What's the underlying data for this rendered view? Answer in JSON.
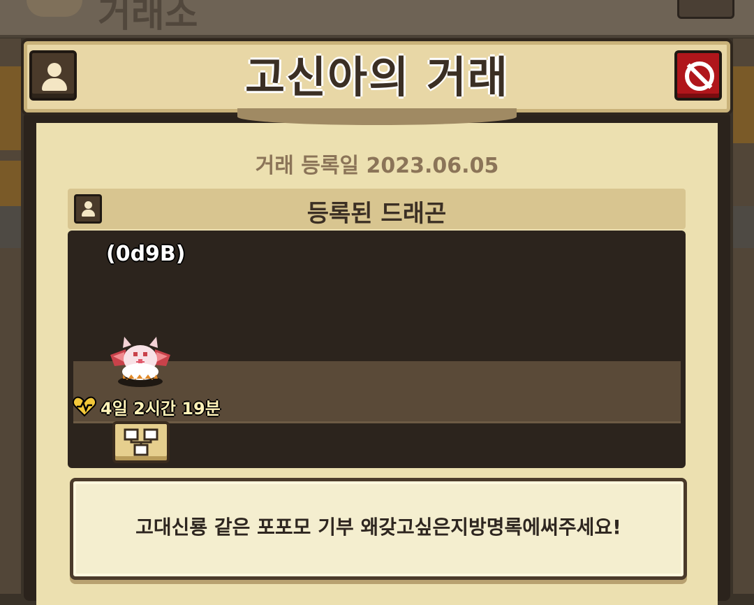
{
  "background": {
    "screen_title": "거래소"
  },
  "dialog": {
    "title": "고신아의 거래",
    "profile_icon": "user-icon",
    "close_icon": "no-entry-icon",
    "registration_date": "거래 등록일 2023.06.05"
  },
  "dragon_section": {
    "header": "등록된 드래곤",
    "header_icon": "user-icon",
    "dragon_code": "(0d9B)",
    "life_icon": "heart-pulse-icon",
    "time_remaining": "4일 2시간 19분",
    "family_tree_icon": "family-tree-icon"
  },
  "message": {
    "text": "고대신룡 같은 포포모 기부 왜갖고싶은지방명록에써주세요!"
  },
  "colors": {
    "panel_bg": "#ece0b0",
    "header_bg": "#e8d7a6",
    "dark_panel": "#2c241d",
    "close_red": "#b0161b",
    "gold_text": "#fff2b8"
  }
}
